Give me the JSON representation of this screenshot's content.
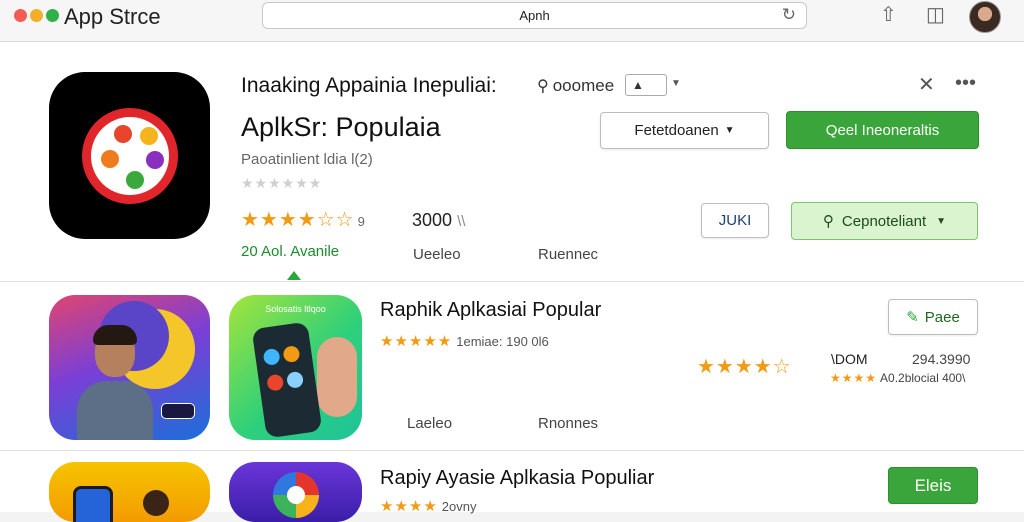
{
  "titlebar": {
    "app_title": "App Strce",
    "search_value": "Apnh",
    "light_colors": [
      "#f25c54",
      "#f2b02a",
      "#2fb14a"
    ]
  },
  "header": {
    "heading": "Inaaking Appainia Inepuliai:",
    "search_label": "ooomee",
    "select_value": "▲"
  },
  "featured": {
    "title": "AplkSr: Populaia",
    "subtitle": "Paoatinlient ldia l(2)",
    "empty_stars": "★★★★★★",
    "stars": "★★★★☆☆",
    "rating_num": "9",
    "count": "3000",
    "count_suffix": "\\\\",
    "link": "20  Aol. Avanile",
    "tab_1": "Ueeleo",
    "tab_2": "Ruennec",
    "btn_select": "Fetetdoanen",
    "btn_primary": "Qeel Ineoneraltis",
    "btn_small": "JUKI",
    "btn_secondary": "Cepnoteliant"
  },
  "row2": {
    "tile_caption": "Solosatis ltlqoo",
    "title": "Raphik Aplkasiai Popular",
    "stars": "★★★★★",
    "meta": "1emiae: 190 0l6",
    "button": "Paee",
    "right_stars": "★★★★☆",
    "right_count": "\\DOM",
    "right_num": "294.3990",
    "right_sub_stars": "★★★★",
    "right_sub_text": "A0.2blocial 400\\",
    "tab_1": "Laeleo",
    "tab_2": "Rnonnes"
  },
  "row3": {
    "title": "Rapiy Ayasie Aplkasia Populiar",
    "stars": "★★★★",
    "meta": "2ovny",
    "button": "Eleis"
  },
  "colors": {
    "accent_green": "#3aa53a",
    "star": "#f29a14",
    "icon_red": "#e1262b"
  }
}
